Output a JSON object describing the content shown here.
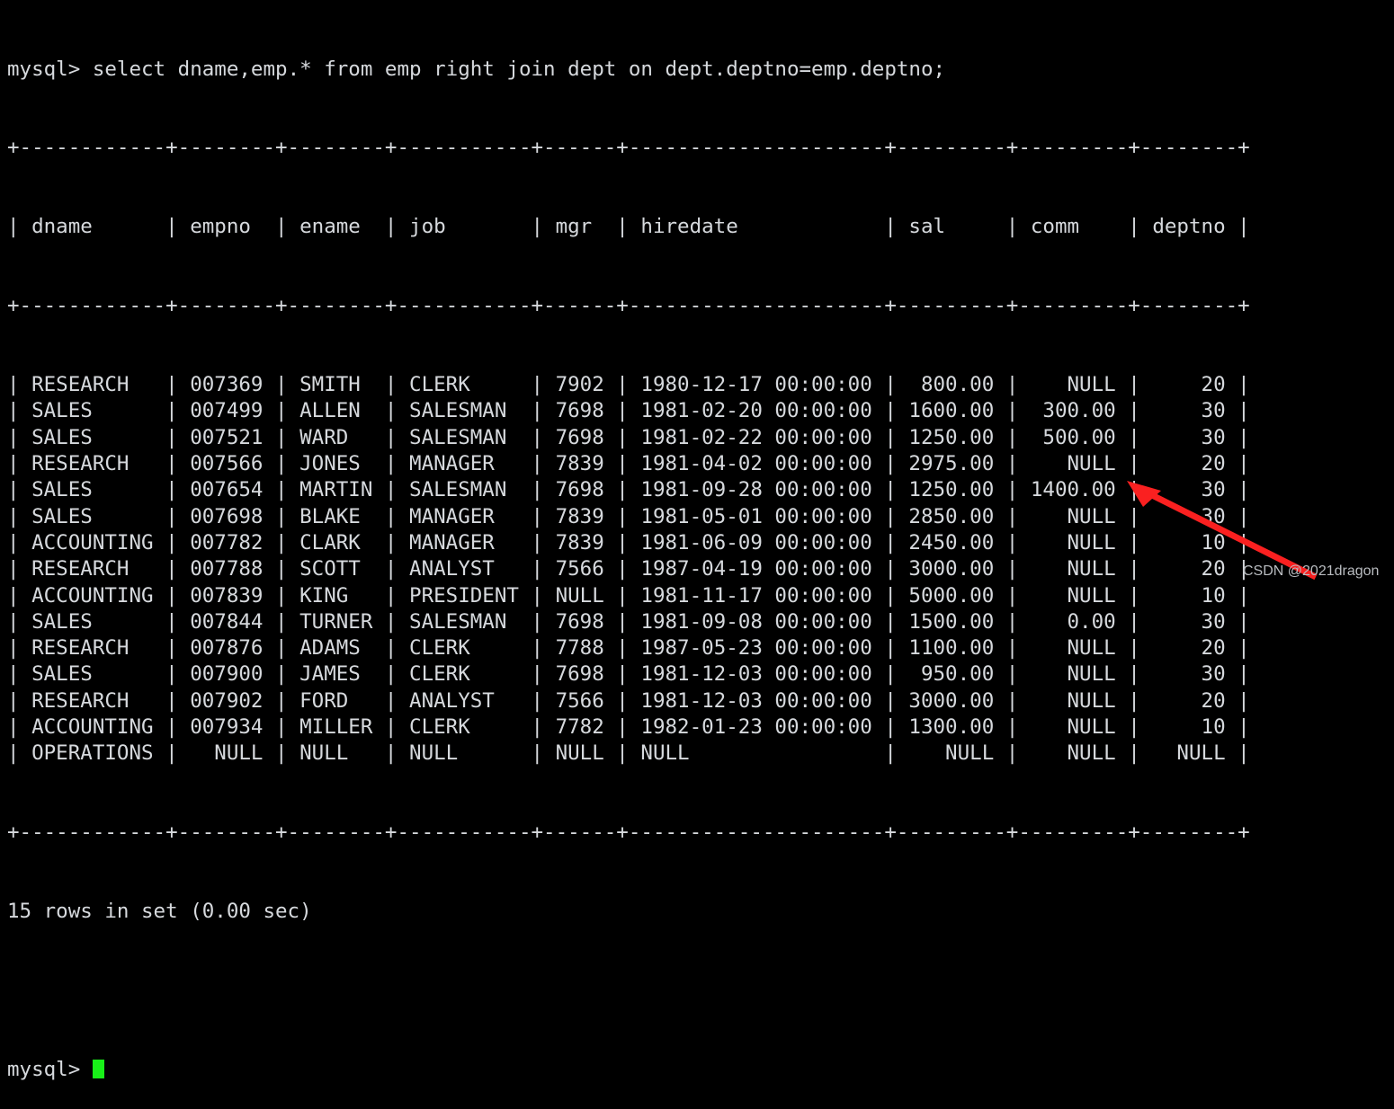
{
  "terminal": {
    "prompt": "mysql> ",
    "query": "select dname,emp.* from emp right join dept on dept.deptno=emp.deptno;",
    "status": "15 rows in set (0.00 sec)",
    "final_prompt": "mysql> ",
    "separator": "+------------+--------+--------+-----------+------+---------------------+---------+---------+--------+",
    "header_line": "| dname      | empno  | ename  | job       | mgr  | hiredate            | sal     | comm    | deptno |",
    "colors": {
      "background": "#000000",
      "text": "#d6d9dd",
      "cursor": "#18f018",
      "arrow": "#fa2020",
      "watermark": "#b9bcc0"
    }
  },
  "table": {
    "columns": [
      "dname",
      "empno",
      "ename",
      "job",
      "mgr",
      "hiredate",
      "sal",
      "comm",
      "deptno"
    ],
    "rows": [
      {
        "dname": "RESEARCH",
        "empno": "007369",
        "ename": "SMITH",
        "job": "CLERK",
        "mgr": "7902",
        "hiredate": "1980-12-17 00:00:00",
        "sal": "800.00",
        "comm": "NULL",
        "deptno": "20"
      },
      {
        "dname": "SALES",
        "empno": "007499",
        "ename": "ALLEN",
        "job": "SALESMAN",
        "mgr": "7698",
        "hiredate": "1981-02-20 00:00:00",
        "sal": "1600.00",
        "comm": "300.00",
        "deptno": "30"
      },
      {
        "dname": "SALES",
        "empno": "007521",
        "ename": "WARD",
        "job": "SALESMAN",
        "mgr": "7698",
        "hiredate": "1981-02-22 00:00:00",
        "sal": "1250.00",
        "comm": "500.00",
        "deptno": "30"
      },
      {
        "dname": "RESEARCH",
        "empno": "007566",
        "ename": "JONES",
        "job": "MANAGER",
        "mgr": "7839",
        "hiredate": "1981-04-02 00:00:00",
        "sal": "2975.00",
        "comm": "NULL",
        "deptno": "20"
      },
      {
        "dname": "SALES",
        "empno": "007654",
        "ename": "MARTIN",
        "job": "SALESMAN",
        "mgr": "7698",
        "hiredate": "1981-09-28 00:00:00",
        "sal": "1250.00",
        "comm": "1400.00",
        "deptno": "30"
      },
      {
        "dname": "SALES",
        "empno": "007698",
        "ename": "BLAKE",
        "job": "MANAGER",
        "mgr": "7839",
        "hiredate": "1981-05-01 00:00:00",
        "sal": "2850.00",
        "comm": "NULL",
        "deptno": "30"
      },
      {
        "dname": "ACCOUNTING",
        "empno": "007782",
        "ename": "CLARK",
        "job": "MANAGER",
        "mgr": "7839",
        "hiredate": "1981-06-09 00:00:00",
        "sal": "2450.00",
        "comm": "NULL",
        "deptno": "10"
      },
      {
        "dname": "RESEARCH",
        "empno": "007788",
        "ename": "SCOTT",
        "job": "ANALYST",
        "mgr": "7566",
        "hiredate": "1987-04-19 00:00:00",
        "sal": "3000.00",
        "comm": "NULL",
        "deptno": "20"
      },
      {
        "dname": "ACCOUNTING",
        "empno": "007839",
        "ename": "KING",
        "job": "PRESIDENT",
        "mgr": "NULL",
        "hiredate": "1981-11-17 00:00:00",
        "sal": "5000.00",
        "comm": "NULL",
        "deptno": "10"
      },
      {
        "dname": "SALES",
        "empno": "007844",
        "ename": "TURNER",
        "job": "SALESMAN",
        "mgr": "7698",
        "hiredate": "1981-09-08 00:00:00",
        "sal": "1500.00",
        "comm": "0.00",
        "deptno": "30"
      },
      {
        "dname": "RESEARCH",
        "empno": "007876",
        "ename": "ADAMS",
        "job": "CLERK",
        "mgr": "7788",
        "hiredate": "1987-05-23 00:00:00",
        "sal": "1100.00",
        "comm": "NULL",
        "deptno": "20"
      },
      {
        "dname": "SALES",
        "empno": "007900",
        "ename": "JAMES",
        "job": "CLERK",
        "mgr": "7698",
        "hiredate": "1981-12-03 00:00:00",
        "sal": "950.00",
        "comm": "NULL",
        "deptno": "30"
      },
      {
        "dname": "RESEARCH",
        "empno": "007902",
        "ename": "FORD",
        "job": "ANALYST",
        "mgr": "7566",
        "hiredate": "1981-12-03 00:00:00",
        "sal": "3000.00",
        "comm": "NULL",
        "deptno": "20"
      },
      {
        "dname": "ACCOUNTING",
        "empno": "007934",
        "ename": "MILLER",
        "job": "CLERK",
        "mgr": "7782",
        "hiredate": "1982-01-23 00:00:00",
        "sal": "1300.00",
        "comm": "NULL",
        "deptno": "10"
      },
      {
        "dname": "OPERATIONS",
        "empno": "NULL",
        "ename": "NULL",
        "job": "NULL",
        "mgr": "NULL",
        "hiredate": "NULL",
        "sal": "NULL",
        "comm": "NULL",
        "deptno": "NULL"
      }
    ]
  },
  "annotation": {
    "watermark": "CSDN @2021dragon",
    "arrow_label": "red-arrow-pointing-to-operations-row"
  }
}
